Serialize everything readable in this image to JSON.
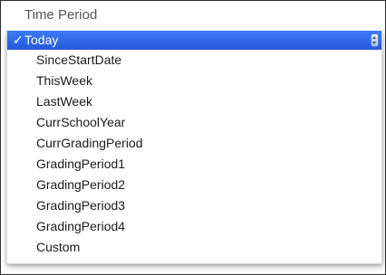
{
  "field": {
    "label": "Time Period"
  },
  "menu": {
    "selected_index": 0,
    "check_mark": "✓",
    "items": [
      "Today",
      "SinceStartDate",
      "ThisWeek",
      "LastWeek",
      "CurrSchoolYear",
      "CurrGradingPeriod",
      "GradingPeriod1",
      "GradingPeriod2",
      "GradingPeriod3",
      "GradingPeriod4",
      "Custom"
    ]
  },
  "colors": {
    "selection": "#2f6aea",
    "text": "#1a1a1a",
    "label": "#555555"
  },
  "icons": {
    "check": "checkmark-icon",
    "stepper": "updown-arrows-icon"
  }
}
